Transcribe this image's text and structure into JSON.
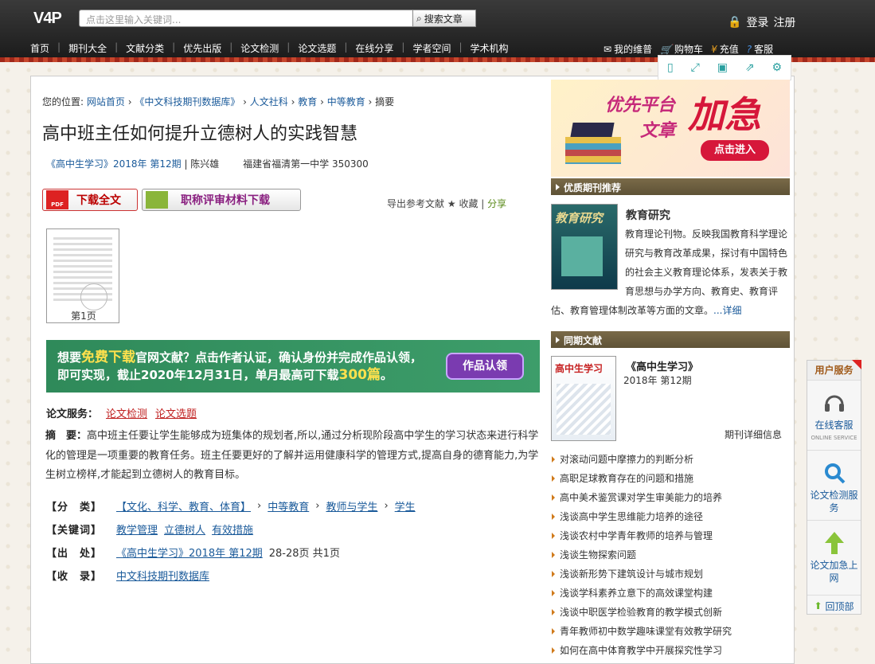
{
  "header": {
    "logo": "V4P",
    "search_placeholder": "点击这里输入关键词...",
    "search_button": "搜索文章",
    "login": "登录",
    "register": "注册",
    "nav": [
      "首页",
      "期刊大全",
      "文献分类",
      "优先出版",
      "论文检测",
      "论文选题",
      "在线分享",
      "学者空间",
      "学术机构"
    ],
    "right_nav": [
      "我的维普",
      "购物车",
      "充值",
      "客服"
    ]
  },
  "breadcrumb": {
    "prefix": "您的位置:",
    "items": [
      "网站首页",
      "《中文科技期刊数据库》",
      "人文社科",
      "教育",
      "中等教育",
      "摘要"
    ]
  },
  "article": {
    "title": "高中班主任如何提升立德树人的实践智慧",
    "journal": "《高中生学习》2018年 第12期",
    "author": "陈兴雄",
    "affiliation": "福建省福清第一中学  350300",
    "download_full": "下载全文",
    "download_material": "职称评审材料下载",
    "export": "导出参考文献",
    "favorite": "收藏",
    "share": "分享",
    "page_label": "第1页"
  },
  "banner": {
    "line1_a": "想要",
    "line1_b": "免费下载",
    "line1_c": "官网文献？点击作者认证，确认身份并完成作品认领，",
    "line2_a": "即可实现，截止2020年12月31日，单月最高可下载",
    "line2_b": "300篇",
    "line2_c": "。",
    "button": "作品认领"
  },
  "services": {
    "label": "论文服务：",
    "links": [
      "论文检测",
      "论文选题"
    ]
  },
  "abstract": {
    "label": "摘　要：",
    "text": "高中班主任要让学生能够成为班集体的规划者,所以,通过分析现阶段高中学生的学习状态来进行科学化的管理是一项重要的教育任务。班主任要更好的了解并运用健康科学的管理方式,提高自身的德育能力,为学生树立榜样,才能起到立德树人的教育目标。"
  },
  "details": {
    "category_label": "【分　类】",
    "category": [
      "【文化、科学、教育、体育】",
      "中等教育",
      "教师与学生",
      "学生"
    ],
    "keywords_label": "【关键词】",
    "keywords": [
      "教学管理",
      "立德树人",
      "有效措施"
    ],
    "source_label": "【出　处】",
    "source": "《高中生学习》2018年 第12期",
    "pages": "28-28页  共1页",
    "database_label": "【收　录】",
    "database": "中文科技期刊数据库"
  },
  "sidebar": {
    "ad": {
      "line1": "优先平台",
      "line2": "文章",
      "big": "加急",
      "button": "点击进入"
    },
    "recommended_title": "优质期刊推荐",
    "journal_cover_text": "教育研究",
    "journal_name": "教育研究",
    "journal_desc_a": "教育理论刊物。反映我国教育科学理论研究与教育改革成果，探讨有中国特色的社会主义教育理论体系，发表关于教育思想与办学方向、教育史、教育评",
    "journal_desc_b": "估、教育管理体制改革等方面的文章。",
    "journal_more": "...详细",
    "same_issue_title": "同期文献",
    "issue_cover_text": "高中生学习",
    "issue_name": "《高中生学习》",
    "issue_no": "2018年 第12期",
    "issue_more": "期刊详细信息",
    "articles": [
      "对滚动问题中摩擦力的判断分析",
      "高职足球教育存在的问题和措施",
      "高中美术鉴赏课对学生审美能力的培养",
      "浅谈高中学生思维能力培养的途径",
      "浅谈农村中学青年教师的培养与管理",
      "浅谈生物探索问题",
      "浅谈新形势下建筑设计与城市规划",
      "浅谈学科素养立意下的高效课堂构建",
      "浅谈中职医学检验教育的教学模式创新",
      "青年教师初中数学趣味课堂有效教学研究",
      "如何在高中体育教学中开展探究性学习"
    ]
  },
  "float": {
    "title": "用户服务",
    "online": "在线客服",
    "online_en": "ONLINE SERVICE",
    "detect": "论文检测服务",
    "boost": "论文加急上网",
    "top": "回顶部"
  }
}
